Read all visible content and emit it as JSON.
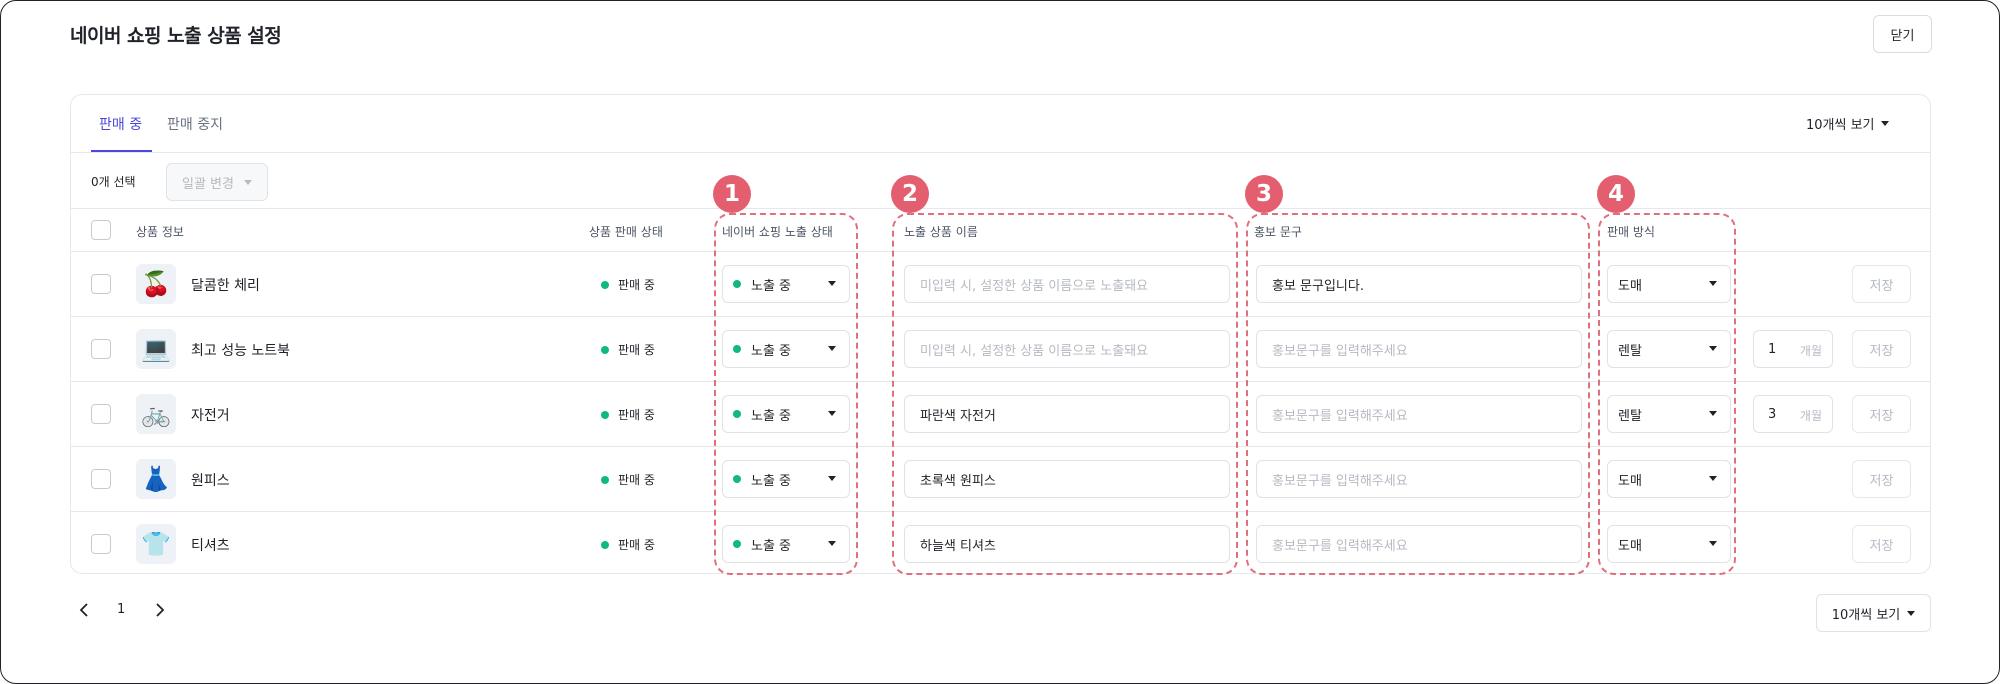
{
  "title": "네이버 쇼핑 노출 상품 설정",
  "close_label": "닫기",
  "tabs": [
    {
      "label": "판매 중",
      "active": true
    },
    {
      "label": "판매 중지",
      "active": false
    }
  ],
  "page_size_label": "10개씩 보기",
  "selection_count": "0개 선택",
  "bulk_change_label": "일괄 변경",
  "columns": {
    "product_info": "상품 정보",
    "sale_status": "상품 판매 상태",
    "exposure_status": "네이버 쇼핑 노출 상태",
    "exposure_name": "노출 상품 이름",
    "promo_text": "홍보 문구",
    "sale_method": "판매 방식"
  },
  "placeholders": {
    "exposure_name": "미입력 시, 설정한 상품 이름으로 노출돼요",
    "promo_text": "홍보문구를 입력해주세요"
  },
  "period_unit": "개월",
  "save_label": "저장",
  "rows": [
    {
      "thumb_icon": "cherry-icon",
      "thumb": "🍒",
      "name": "달콤한 체리",
      "status": "판매 중",
      "exposure": "노출 중",
      "exposure_name": "",
      "promo": "홍보 문구입니다.",
      "method": "도매",
      "period": ""
    },
    {
      "thumb_icon": "laptop-icon",
      "thumb": "💻",
      "name": "최고 성능 노트북",
      "status": "판매 중",
      "exposure": "노출 중",
      "exposure_name": "",
      "promo": "",
      "method": "렌탈",
      "period": "1"
    },
    {
      "thumb_icon": "bicycle-icon",
      "thumb": "🚲",
      "name": "자전거",
      "status": "판매 중",
      "exposure": "노출 중",
      "exposure_name": "파란색 자전거",
      "promo": "",
      "method": "렌탈",
      "period": "3"
    },
    {
      "thumb_icon": "dress-icon",
      "thumb": "👗",
      "name": "원피스",
      "status": "판매 중",
      "exposure": "노출 중",
      "exposure_name": "초록색 원피스",
      "promo": "",
      "method": "도매",
      "period": ""
    },
    {
      "thumb_icon": "tshirt-icon",
      "thumb": "👕",
      "name": "티셔츠",
      "status": "판매 중",
      "exposure": "노출 중",
      "exposure_name": "하늘색 티셔츠",
      "promo": "",
      "method": "도매",
      "period": ""
    }
  ],
  "annotations": [
    "1",
    "2",
    "3",
    "4"
  ],
  "pagination": {
    "current_page": "1"
  },
  "colors": {
    "accent": "#4b48d6",
    "status_green": "#10b981",
    "annotation": "#e35f70"
  }
}
